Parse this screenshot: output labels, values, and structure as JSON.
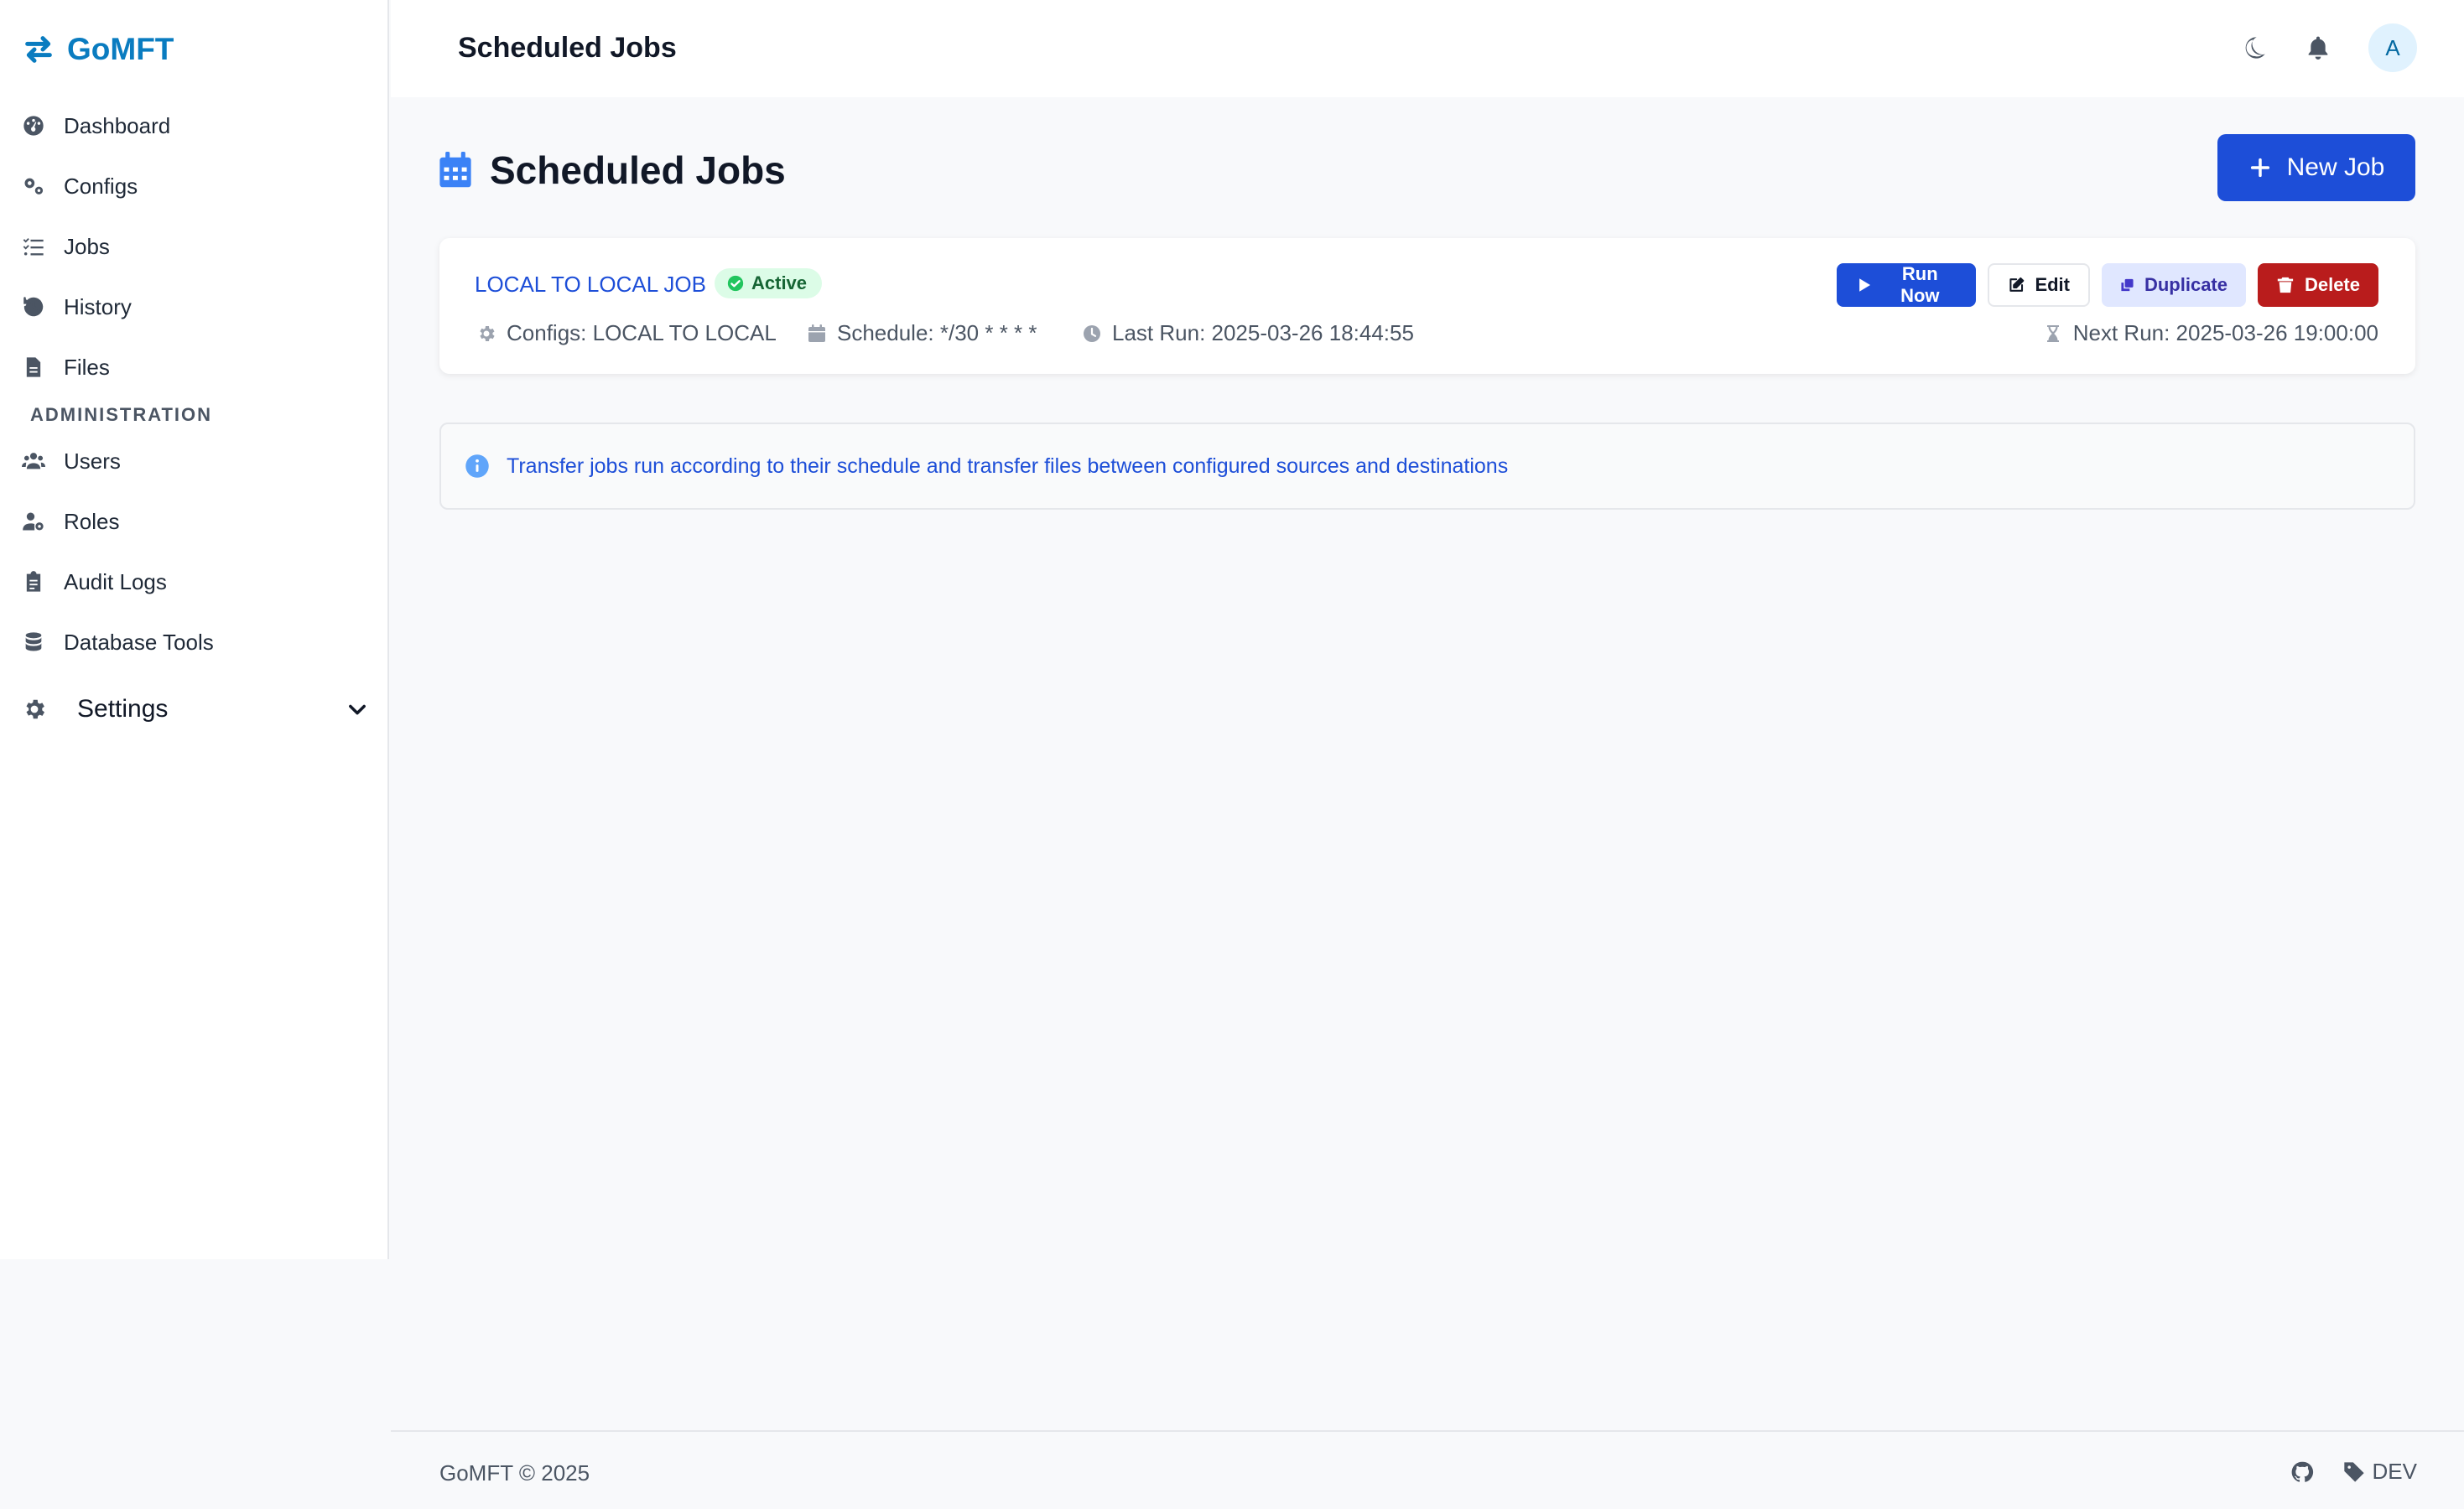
{
  "brand": {
    "name": "GoMFT"
  },
  "sidebar": {
    "items": [
      {
        "label": "Dashboard",
        "icon": "dashboard-icon"
      },
      {
        "label": "Configs",
        "icon": "cogs-icon"
      },
      {
        "label": "Jobs",
        "icon": "tasks-icon"
      },
      {
        "label": "History",
        "icon": "history-icon"
      },
      {
        "label": "Files",
        "icon": "file-icon"
      }
    ],
    "section_label": "ADMINISTRATION",
    "admin_items": [
      {
        "label": "Users",
        "icon": "users-icon"
      },
      {
        "label": "Roles",
        "icon": "user-cog-icon"
      },
      {
        "label": "Audit Logs",
        "icon": "clipboard-icon"
      },
      {
        "label": "Database Tools",
        "icon": "database-icon"
      }
    ],
    "settings": {
      "label": "Settings"
    }
  },
  "topbar": {
    "title": "Scheduled Jobs",
    "avatar_initial": "A"
  },
  "page": {
    "title": "Scheduled Jobs",
    "new_job_label": "New Job"
  },
  "job": {
    "name": "LOCAL TO LOCAL JOB",
    "status": "Active",
    "configs": "Configs: LOCAL TO LOCAL",
    "schedule": "Schedule: */30 * * * *",
    "last_run": "Last Run: 2025-03-26 18:44:55",
    "next_run": "Next Run: 2025-03-26 19:00:00",
    "actions": {
      "run_now": "Run Now",
      "edit": "Edit",
      "duplicate": "Duplicate",
      "delete": "Delete"
    }
  },
  "info": {
    "message": "Transfer jobs run according to their schedule and transfer files between configured sources and destinations"
  },
  "footer": {
    "copyright": "GoMFT © 2025",
    "env": "DEV"
  },
  "colors": {
    "brand": "#0a7cc0",
    "primary": "#1d4ed8",
    "danger": "#b91c1c",
    "success_bg": "#dcfce7"
  }
}
